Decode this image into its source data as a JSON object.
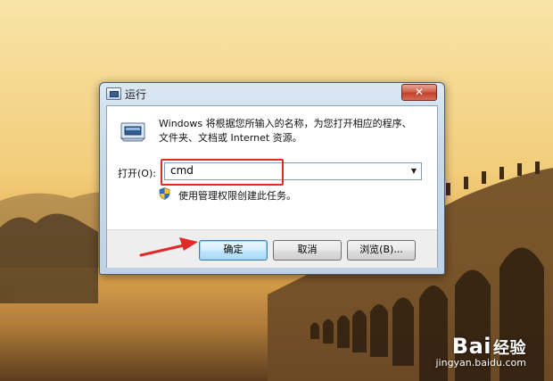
{
  "window": {
    "title": "运行",
    "close_label": "✕",
    "description_line1": "Windows 将根据您所输入的名称，为您打开相应的程序、",
    "description_line2": "文件夹、文档或 Internet 资源。",
    "open_label": "打开(O):",
    "command_value": "cmd",
    "admin_note": "使用管理权限创建此任务。",
    "buttons": {
      "ok": "确定",
      "cancel": "取消",
      "browse": "浏览(B)..."
    }
  },
  "watermark": {
    "logo": "Bai",
    "logo_suffix": "经验",
    "url": "jingyan.baidu.com"
  },
  "colors": {
    "highlight": "#e12b2b",
    "arrow": "#e12b2b",
    "ok_border": "#3c7fb1"
  },
  "icons": [
    "run-icon",
    "shield-icon",
    "close-icon",
    "dropdown-arrow-icon"
  ]
}
